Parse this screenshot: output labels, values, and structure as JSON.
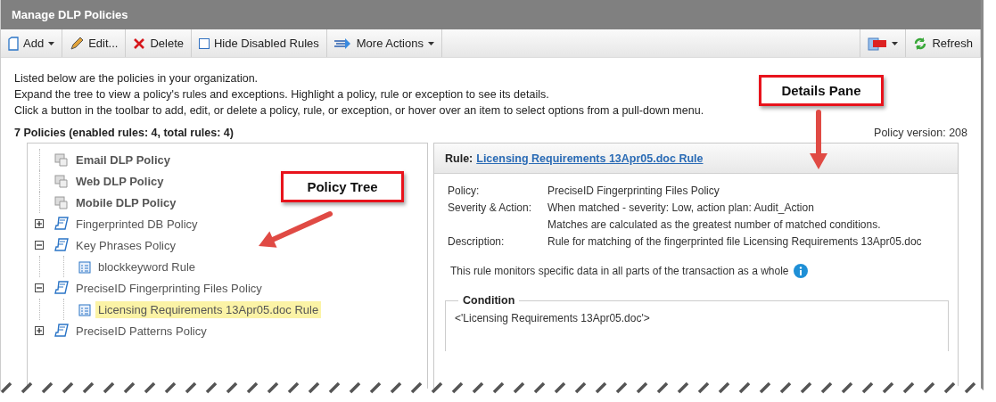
{
  "window": {
    "title": "Manage DLP Policies"
  },
  "toolbar": {
    "left": [
      {
        "kind": "add",
        "label": "Add",
        "dropdown": true
      },
      {
        "kind": "edit",
        "label": "Edit...",
        "dropdown": false
      },
      {
        "kind": "delete",
        "label": "Delete",
        "dropdown": false
      },
      {
        "kind": "checkbox",
        "label": "Hide Disabled Rules",
        "checked": false
      },
      {
        "kind": "more",
        "label": "More Actions",
        "dropdown": true
      }
    ],
    "right": [
      {
        "kind": "pdf",
        "dropdown": true
      },
      {
        "kind": "refresh",
        "label": "Refresh",
        "dropdown": false
      }
    ]
  },
  "intro": [
    "Listed below are the policies in your organization.",
    "Expand the tree to view a policy's rules and exceptions. Highlight a policy, rule or exception to see its details.",
    "Click a button in the toolbar to add, edit, or delete a policy, rule, or exception, or hover over an item to select options from a pull-down menu."
  ],
  "summary": "7 Policies (enabled rules: 4, total rules: 4)",
  "policy_version": "Policy version: 208",
  "tree": [
    {
      "label": "Email DLP Policy",
      "kind": "built-in",
      "selected": false
    },
    {
      "label": "Web DLP Policy",
      "kind": "built-in",
      "selected": false
    },
    {
      "label": "Mobile DLP Policy",
      "kind": "built-in",
      "selected": false
    },
    {
      "label": "Fingerprinted DB Policy",
      "kind": "policy",
      "expanded": false,
      "selected": false
    },
    {
      "label": "Key Phrases Policy",
      "kind": "policy",
      "expanded": true,
      "selected": false,
      "children": [
        {
          "label": "blockkeyword Rule",
          "kind": "rule",
          "selected": false
        }
      ]
    },
    {
      "label": "PreciseID Fingerprinting Files Policy",
      "kind": "policy",
      "expanded": true,
      "selected": false,
      "children": [
        {
          "label": "Licensing Requirements 13Apr05.doc Rule",
          "kind": "rule",
          "selected": true
        }
      ]
    },
    {
      "label": "PreciseID Patterns Policy",
      "kind": "policy",
      "expanded": false,
      "selected": false
    }
  ],
  "details": {
    "header_label": "Rule:",
    "header_link": "Licensing Requirements 13Apr05.doc Rule",
    "fields": [
      {
        "label": "Policy:",
        "value": "PreciseID Fingerprinting Files Policy"
      },
      {
        "label": "Severity & Action:",
        "value": "When matched - severity: Low, action plan: Audit_Action"
      },
      {
        "value": "Matches are calculated as the greatest number of matched conditions."
      },
      {
        "label": "Description:",
        "value": "Rule for matching of the fingerprinted file Licensing Requirements 13Apr05.doc"
      }
    ],
    "note": "This rule monitors specific data in all parts of the transaction as a whole",
    "condition": {
      "legend": "Condition",
      "text": "<'Licensing Requirements 13Apr05.doc'>"
    }
  },
  "callouts": [
    {
      "label": "Details Pane"
    },
    {
      "label": "Policy Tree"
    }
  ]
}
